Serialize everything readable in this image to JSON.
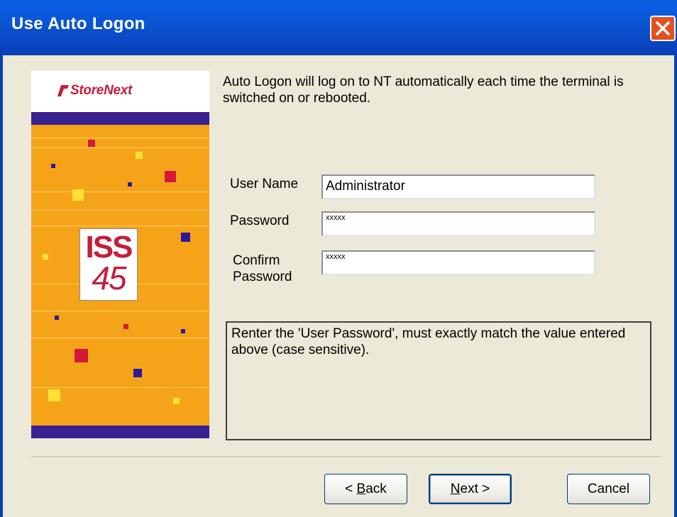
{
  "window": {
    "title": "Use Auto Logon"
  },
  "banner": {
    "brand": "StoreNext",
    "product_top": "ISS",
    "product_bottom": "45"
  },
  "description": "Auto Logon will log on to NT automatically each time the terminal is switched on or rebooted.",
  "form": {
    "username_label": "User Name",
    "username_value": "Administrator",
    "password_label": "Password",
    "password_value": "xxxxx",
    "confirm_label_line1": "Confirm",
    "confirm_label_line2": "Password",
    "confirm_value": "xxxxx"
  },
  "help_text": "Renter the 'User Password', must exactly match the value entered above (case sensitive).",
  "buttons": {
    "back_prefix": "< ",
    "back_hotkey": "B",
    "back_rest": "ack",
    "next_hotkey": "N",
    "next_rest": "ext >",
    "cancel": "Cancel"
  },
  "colors": {
    "titlebar": "#0a53d0",
    "close_button": "#e0521f",
    "banner_orange": "#f5a41a",
    "banner_purple": "#3a2090",
    "brand_red": "#c41e3a",
    "dialog_bg": "#ece9d8"
  },
  "icons": {
    "close": "close-x-icon"
  }
}
